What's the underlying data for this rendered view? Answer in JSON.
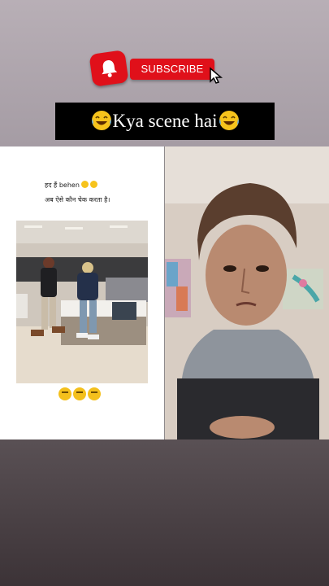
{
  "subscribe": {
    "label": "SUBSCRIBE"
  },
  "title": {
    "text": "Kya scene hai",
    "emoji_left": "laughing-tears-emoji",
    "emoji_right": "laughing-tears-emoji"
  },
  "post": {
    "line1": "हद हैं behen",
    "line2": "अब ऐसे कौन चेक करता है।",
    "reaction_emojis": [
      "thinking-emoji",
      "thinking-emoji",
      "thinking-emoji"
    ]
  },
  "colors": {
    "subscribe_red": "#e0101a",
    "title_bg": "#000000"
  }
}
